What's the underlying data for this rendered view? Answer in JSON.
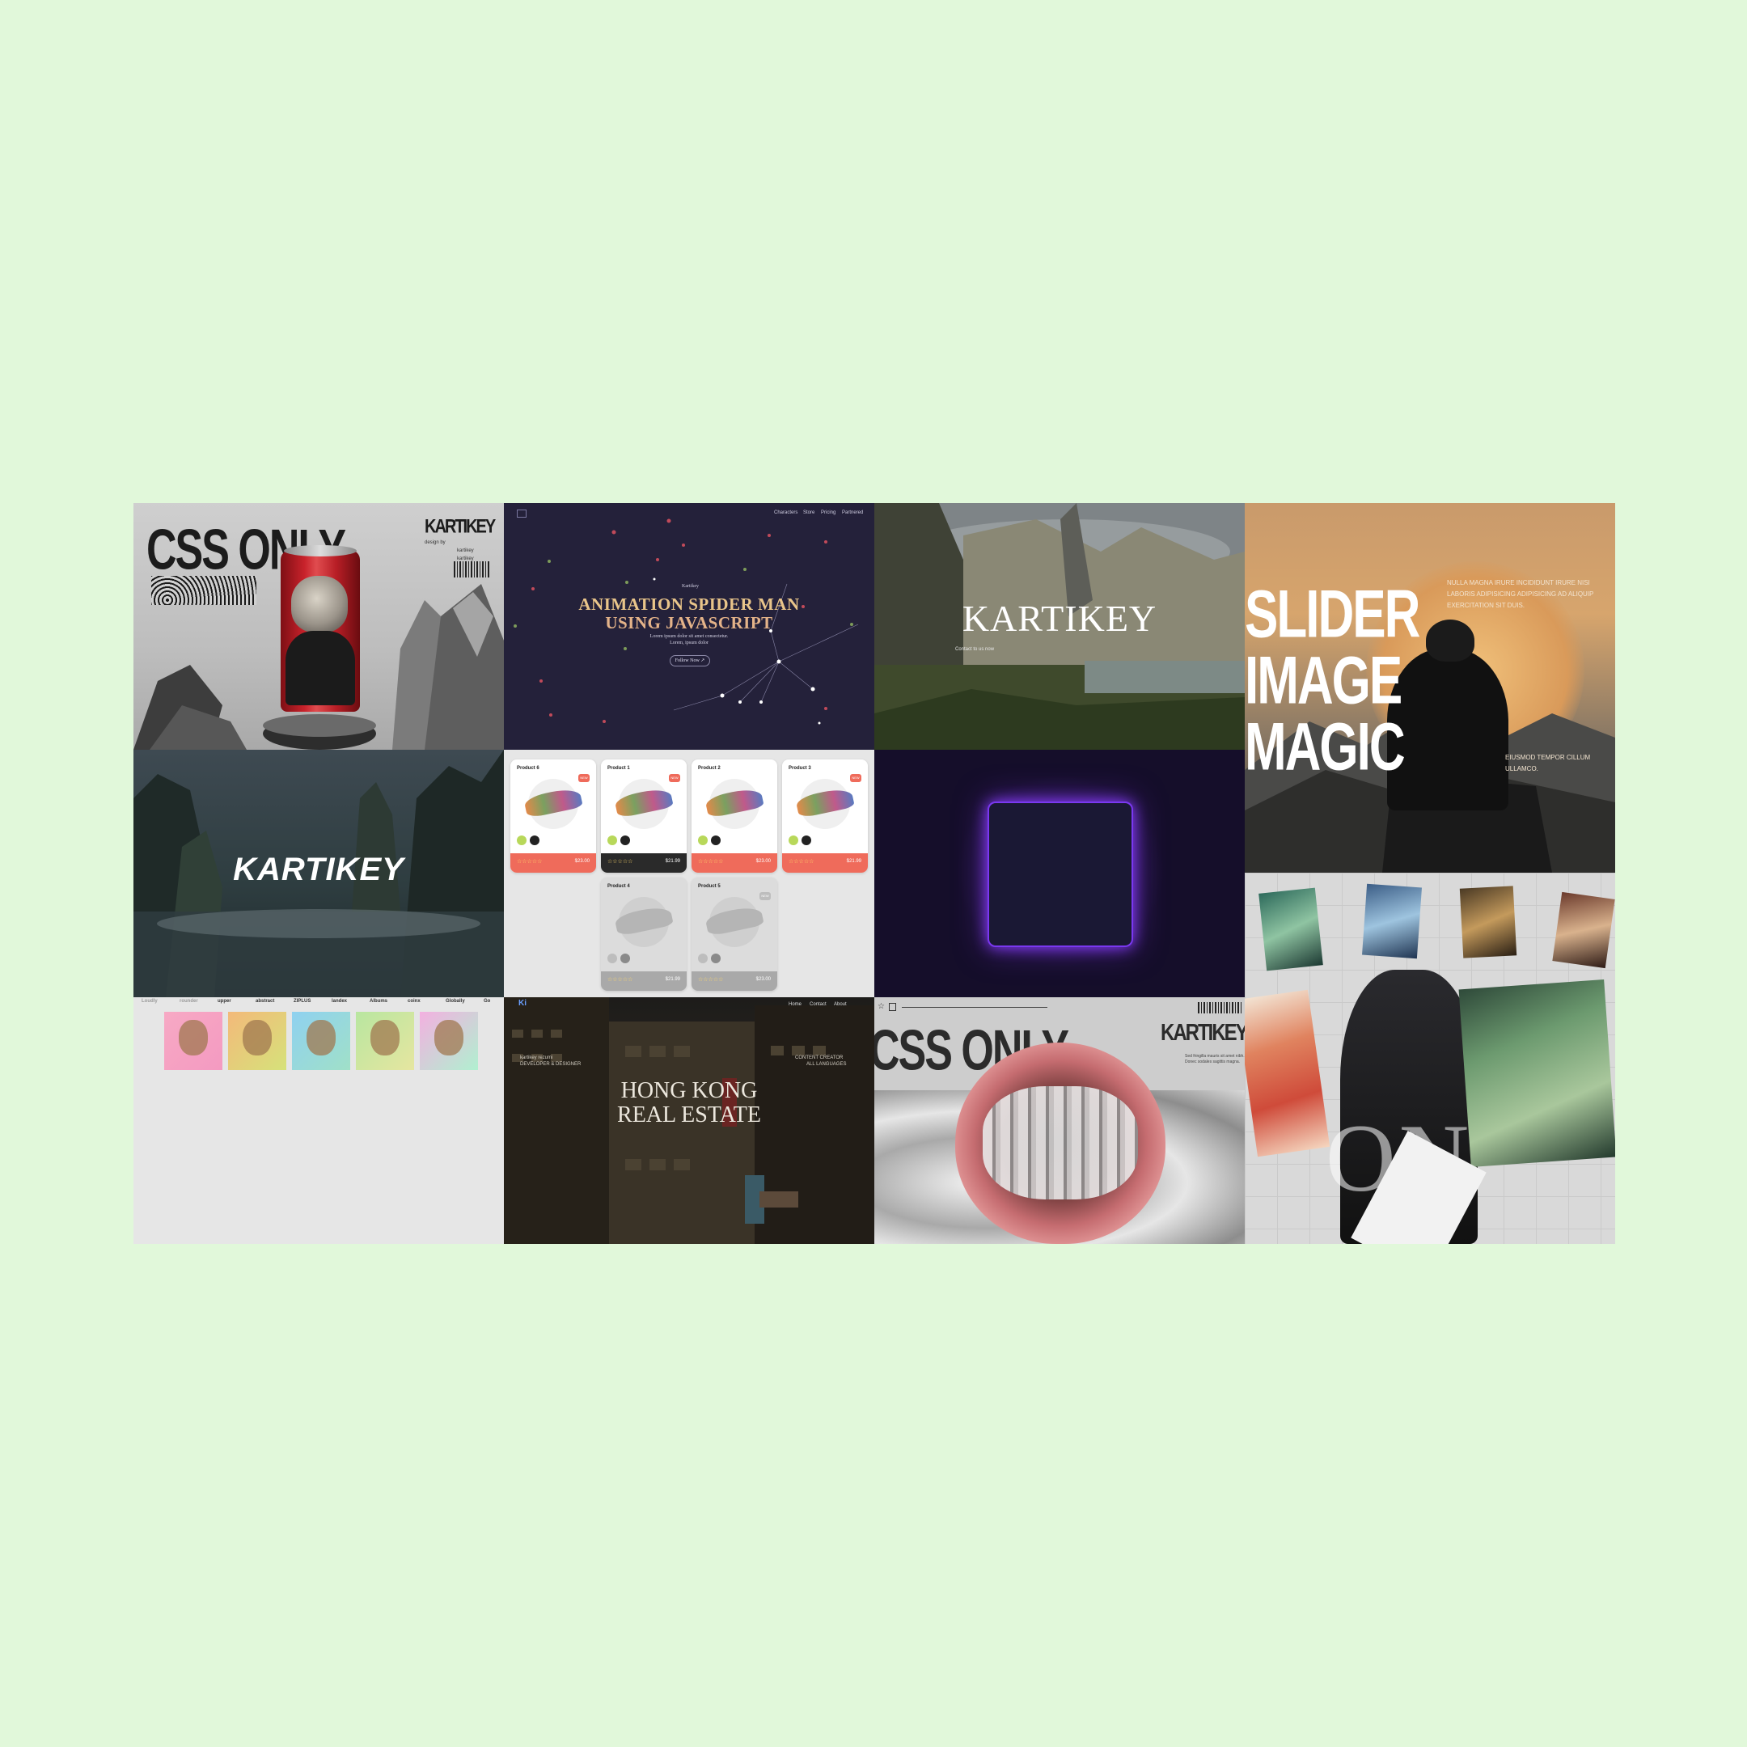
{
  "tiles": {
    "css_only_can": {
      "headline": "CSS ONLY",
      "brand": "KARTIKEY",
      "small_lines": [
        "design by",
        "kartikey",
        "kartikey"
      ]
    },
    "spider_man": {
      "nav": [
        "Characters",
        "Store",
        "Pricing",
        "Partnered"
      ],
      "eyebrow": "Kartikey",
      "title_line1": "ANIMATION SPIDER MAN",
      "title_line2": "USING JAVASCRIPT",
      "subtitle_line1": "Lorem ipsum dolor sit amet consectetur.",
      "subtitle_line2": "Lorem, ipsum dolor",
      "button": "Follow Now ↗"
    },
    "landscape": {
      "title": "KARTIKEY",
      "subtitle": "Contact to us now"
    },
    "slider": {
      "line1": "SLIDER",
      "line2": "IMAGE",
      "line3": "MAGIC",
      "copy_top": "NULLA MAGNA IRURE INCIDIDUNT IRURE NISI LABORIS ADIPISICING ADIPISICING AD ALIQUIP EXERCITATION SIT DUIS.",
      "copy_bottom": "EIUSMOD TEMPOR CILLUM ULLAMCO."
    },
    "kartikey_brush": {
      "title": "KARTIKEY"
    },
    "products": {
      "cards": [
        {
          "name": "Product 6",
          "price": "$23.00",
          "badge": "NEW",
          "theme": "coral"
        },
        {
          "name": "Product 1",
          "price": "$21.99",
          "badge": "NEW",
          "theme": "dark"
        },
        {
          "name": "Product 2",
          "price": "$23.00",
          "badge": "",
          "theme": "coral"
        },
        {
          "name": "Product 3",
          "price": "$21.99",
          "badge": "NEW",
          "theme": "coral"
        },
        {
          "name": "Product 4",
          "price": "$21.99",
          "badge": "",
          "theme": "muted"
        },
        {
          "name": "Product 5",
          "price": "$23.00",
          "badge": "NEW",
          "theme": "muted"
        }
      ],
      "stars": "☆☆☆☆☆"
    },
    "nft": {
      "logos": [
        "Loudly",
        "rounder",
        "upper",
        "abstract",
        "ZIPLUS",
        "landex",
        "Albums",
        "coinx",
        "Globally",
        "Go"
      ]
    },
    "hong_kong": {
      "logo": "Ki",
      "nav": [
        "Home",
        "Contact",
        "About"
      ],
      "left_line1": "kartikey rezumi",
      "left_line2": "DEVELOPER & DESIGNER",
      "right_line1": "CONTENT CREATOR",
      "right_line2": "ALL LANGUAGES",
      "title_line1": "HONG KONG",
      "title_line2": "REAL ESTATE"
    },
    "css_only_mouth": {
      "headline": "CSS ONLY",
      "brand": "KARTIKEY",
      "small_copy": "Sed fringilla mauris sit amet nibh. Donec sodales sagittis magna."
    },
    "dragons": {
      "big_text": "ON"
    }
  },
  "colors": {
    "page_bg": "#e1f8da",
    "coral": "#ef6b5b",
    "dark_card": "#2a2a2a",
    "glow": "#8a3cff",
    "title_gold": "#e9c58a"
  }
}
